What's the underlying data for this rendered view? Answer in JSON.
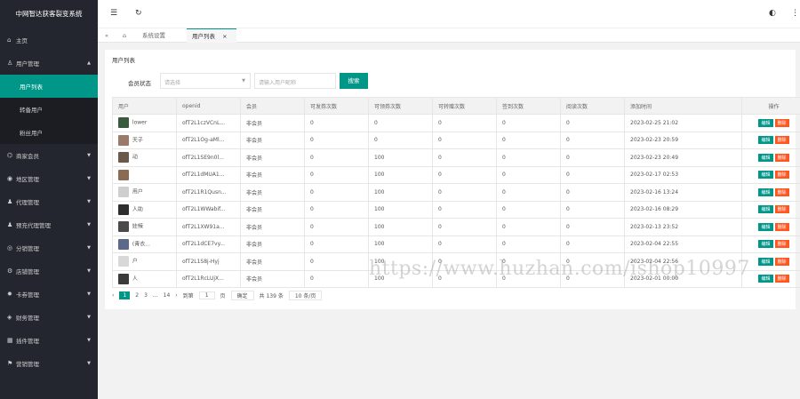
{
  "app": {
    "title": "中网智达获客裂变系统"
  },
  "sidebar": {
    "items": [
      {
        "label": "主页",
        "icon": "home-icon",
        "glyph": "⌂",
        "arrow": ""
      },
      {
        "label": "用户管理",
        "icon": "user-icon",
        "glyph": "♙",
        "arrow": "▲"
      },
      {
        "label": "商家会员",
        "icon": "shop-icon",
        "glyph": "⌬",
        "arrow": "▼"
      },
      {
        "label": "地区管理",
        "icon": "location-icon",
        "glyph": "◉",
        "arrow": "▼"
      },
      {
        "label": "代理管理",
        "icon": "agent-icon",
        "glyph": "♟",
        "arrow": "▼"
      },
      {
        "label": "预充代理管理",
        "icon": "agent-icon",
        "glyph": "♟",
        "arrow": "▼"
      },
      {
        "label": "分销管理",
        "icon": "share-icon",
        "glyph": "◎",
        "arrow": "▼"
      },
      {
        "label": "店铺管理",
        "icon": "store-icon",
        "glyph": "⚙",
        "arrow": "▼"
      },
      {
        "label": "卡券管理",
        "icon": "coupon-icon",
        "glyph": "✹",
        "arrow": "▼"
      },
      {
        "label": "财务管理",
        "icon": "finance-icon",
        "glyph": "◈",
        "arrow": "▼"
      },
      {
        "label": "插件管理",
        "icon": "plugin-icon",
        "glyph": "▦",
        "arrow": "▼"
      },
      {
        "label": "营销管理",
        "icon": "marketing-icon",
        "glyph": "⚑",
        "arrow": "▼"
      }
    ],
    "subitems": [
      {
        "label": "用户列表",
        "active": true
      },
      {
        "label": "转备用户",
        "active": false
      },
      {
        "label": "粉丝用户",
        "active": false
      }
    ]
  },
  "topbar": {
    "menu_glyph": "☰",
    "refresh_glyph": "↻",
    "theme_glyph": "◐",
    "more_glyph": "⋮"
  },
  "tabs": {
    "collapse_glyph": "«",
    "home_glyph": "⌂",
    "items": [
      {
        "label": "系统设置",
        "close": ""
      },
      {
        "label": "用户列表",
        "close": "×"
      }
    ]
  },
  "card": {
    "title": "用户列表"
  },
  "filter": {
    "label": "会员状态",
    "select_placeholder": "请选择",
    "input_placeholder": "请输入用户昵称",
    "search_label": "搜索"
  },
  "table": {
    "headers": [
      "用户",
      "openid",
      "会员",
      "可发券次数",
      "可领券次数",
      "可转赠次数",
      "签到次数",
      "阅读次数",
      "添加时间",
      "操作"
    ],
    "edit_label": "编辑",
    "delete_label": "删除",
    "rows": [
      {
        "avatar": "#3a5a40",
        "user": "  lower",
        "openid": "ofT2L1czVCnL...",
        "member": "非会员",
        "c1": "0",
        "c2": "0",
        "c3": "0",
        "c4": "0",
        "c5": "0",
        "time": "2023-02-25 21:02"
      },
      {
        "avatar": "#9a7b6a",
        "user": "  天子",
        "openid": "ofT2L1Og-aMl...",
        "member": "非会员",
        "c1": "0",
        "c2": "0",
        "c3": "0",
        "c4": "0",
        "c5": "0",
        "time": "2023-02-23 20:59"
      },
      {
        "avatar": "#6b5a4a",
        "user": "  动",
        "openid": "ofT2L1SE9n0l...",
        "member": "非会员",
        "c1": "0",
        "c2": "100",
        "c3": "0",
        "c4": "0",
        "c5": "0",
        "time": "2023-02-23 20:49"
      },
      {
        "avatar": "#8a6c55",
        "user": "  ",
        "openid": "ofT2L1dMUA1...",
        "member": "非会员",
        "c1": "0",
        "c2": "100",
        "c3": "0",
        "c4": "0",
        "c5": "0",
        "time": "2023-02-17 02:53"
      },
      {
        "avatar": "#cfcfcf",
        "user": "  用户",
        "openid": "ofT2L1R1Qusn...",
        "member": "非会员",
        "c1": "0",
        "c2": "100",
        "c3": "0",
        "c4": "0",
        "c5": "0",
        "time": "2023-02-16 13:24"
      },
      {
        "avatar": "#2e2e2e",
        "user": "  人助",
        "openid": "ofT2L1WWabif...",
        "member": "非会员",
        "c1": "0",
        "c2": "100",
        "c3": "0",
        "c4": "0",
        "c5": "0",
        "time": "2023-02-16 08:29"
      },
      {
        "avatar": "#4a4a4a",
        "user": "  娃辣",
        "openid": "ofT2L1XW91a...",
        "member": "非会员",
        "c1": "0",
        "c2": "100",
        "c3": "0",
        "c4": "0",
        "c5": "0",
        "time": "2023-02-13 23:52"
      },
      {
        "avatar": "#5b6a8a",
        "user": "  (青衣...",
        "openid": "ofT2L1dCE7vy...",
        "member": "非会员",
        "c1": "0",
        "c2": "100",
        "c3": "0",
        "c4": "0",
        "c5": "0",
        "time": "2023-02-04 22:55"
      },
      {
        "avatar": "#d8d8d8",
        "user": "  户",
        "openid": "ofT2L1S8j-Hyj",
        "member": "非会员",
        "c1": "0",
        "c2": "100",
        "c3": "0",
        "c4": "0",
        "c5": "0",
        "time": "2023-02-04 22:56"
      },
      {
        "avatar": "#3b3b3b",
        "user": "  人",
        "openid": "ofT2L1RcLUjX...",
        "member": "非会员",
        "c1": "0",
        "c2": "100",
        "c3": "0",
        "c4": "0",
        "c5": "0",
        "time": "2023-02-01 00:00"
      }
    ]
  },
  "pager": {
    "prev": "‹",
    "current": "1",
    "pages": [
      "2",
      "3",
      "...",
      "14"
    ],
    "next": "›",
    "goto_label": "到第",
    "goto_value": "1",
    "page_label": "页",
    "confirm_label": "确定",
    "total_label": "共 139 条",
    "per_page": "10 条/页"
  },
  "watermark": "https://www.huzhan.com/ishop10997"
}
